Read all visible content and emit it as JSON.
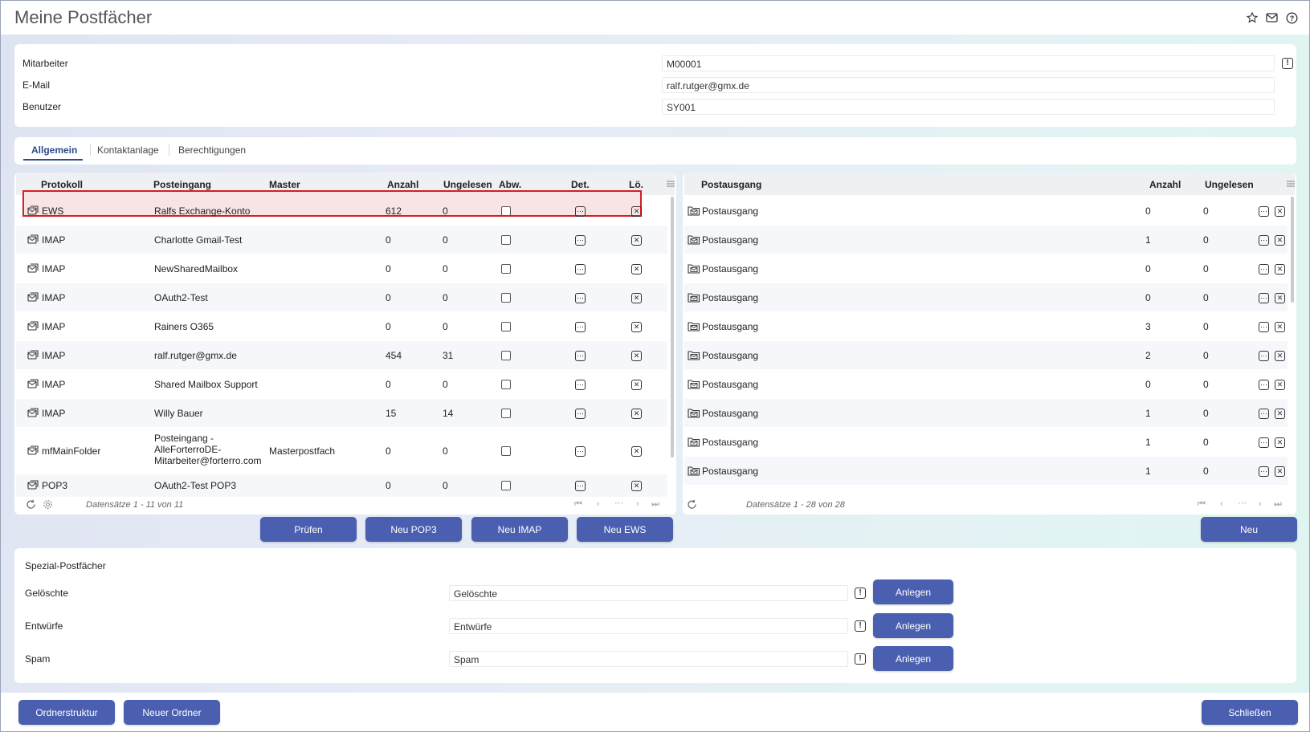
{
  "header": {
    "title": "Meine Postfächer",
    "icons": [
      "star-icon",
      "mail-icon",
      "help-icon"
    ]
  },
  "info": {
    "mitarbeiter_label": "Mitarbeiter",
    "mitarbeiter_value": "M00001",
    "email_label": "E-Mail",
    "email_value": "ralf.rutger@gmx.de",
    "benutzer_label": "Benutzer",
    "benutzer_value": "SY001"
  },
  "tabs": [
    "Allgemein",
    "Kontaktanlage",
    "Berechtigungen"
  ],
  "inbox": {
    "headers": {
      "protokoll": "Protokoll",
      "posteingang": "Posteingang",
      "master": "Master",
      "anzahl": "Anzahl",
      "ungelesen": "Ungelesen",
      "abw": "Abw.",
      "det": "Det.",
      "lo": "Lö."
    },
    "rows": [
      {
        "protokoll": "EWS",
        "posteingang": "Ralfs Exchange-Konto",
        "master": "",
        "anzahl": "612",
        "ungelesen": "0"
      },
      {
        "protokoll": "IMAP",
        "posteingang": "Charlotte Gmail-Test",
        "master": "",
        "anzahl": "0",
        "ungelesen": "0"
      },
      {
        "protokoll": "IMAP",
        "posteingang": "NewSharedMailbox",
        "master": "",
        "anzahl": "0",
        "ungelesen": "0"
      },
      {
        "protokoll": "IMAP",
        "posteingang": "OAuth2-Test",
        "master": "",
        "anzahl": "0",
        "ungelesen": "0"
      },
      {
        "protokoll": "IMAP",
        "posteingang": "Rainers O365",
        "master": "",
        "anzahl": "0",
        "ungelesen": "0"
      },
      {
        "protokoll": "IMAP",
        "posteingang": "ralf.rutger@gmx.de",
        "master": "",
        "anzahl": "454",
        "ungelesen": "31"
      },
      {
        "protokoll": "IMAP",
        "posteingang": "Shared Mailbox Support",
        "master": "",
        "anzahl": "0",
        "ungelesen": "0"
      },
      {
        "protokoll": "IMAP",
        "posteingang": "Willy Bauer",
        "master": "",
        "anzahl": "15",
        "ungelesen": "14"
      },
      {
        "protokoll": "mfMainFolder",
        "posteingang_lines": [
          "Posteingang -",
          "AlleForterroDE-",
          "Mitarbeiter@forterro.com"
        ],
        "master": "Masterpostfach",
        "anzahl": "0",
        "ungelesen": "0"
      },
      {
        "protokoll": "POP3",
        "posteingang": "OAuth2-Test POP3",
        "master": "",
        "anzahl": "0",
        "ungelesen": "0"
      }
    ],
    "footer": "Datensätze 1 - 11 von 11"
  },
  "outbox": {
    "headers": {
      "postausgang": "Postausgang",
      "anzahl": "Anzahl",
      "ungelesen": "Ungelesen"
    },
    "rows": [
      {
        "name": "Postausgang",
        "anzahl": "0",
        "ungelesen": "0"
      },
      {
        "name": "Postausgang",
        "anzahl": "1",
        "ungelesen": "0"
      },
      {
        "name": "Postausgang",
        "anzahl": "0",
        "ungelesen": "0"
      },
      {
        "name": "Postausgang",
        "anzahl": "0",
        "ungelesen": "0"
      },
      {
        "name": "Postausgang",
        "anzahl": "3",
        "ungelesen": "0"
      },
      {
        "name": "Postausgang",
        "anzahl": "2",
        "ungelesen": "0"
      },
      {
        "name": "Postausgang",
        "anzahl": "0",
        "ungelesen": "0"
      },
      {
        "name": "Postausgang",
        "anzahl": "1",
        "ungelesen": "0"
      },
      {
        "name": "Postausgang",
        "anzahl": "1",
        "ungelesen": "0"
      },
      {
        "name": "Postausgang",
        "anzahl": "1",
        "ungelesen": "0"
      }
    ],
    "footer": "Datensätze 1 - 28 von 28"
  },
  "buttons": {
    "pruefen": "Prüfen",
    "neu_pop3": "Neu POP3",
    "neu_imap": "Neu IMAP",
    "neu_ews": "Neu EWS",
    "neu": "Neu",
    "ordnerstruktur": "Ordnerstruktur",
    "neuer_ordner": "Neuer Ordner",
    "schliessen": "Schließen"
  },
  "special": {
    "title": "Spezial-Postfächer",
    "items": [
      {
        "label": "Gelöschte",
        "value": "Gelöschte",
        "button": "Anlegen"
      },
      {
        "label": "Entwürfe",
        "value": "Entwürfe",
        "button": "Anlegen"
      },
      {
        "label": "Spam",
        "value": "Spam",
        "button": "Anlegen"
      }
    ]
  },
  "colors": {
    "primary": "#4a5fb0",
    "tab_active": "#2d4a8a",
    "selection_border": "#d32020"
  }
}
